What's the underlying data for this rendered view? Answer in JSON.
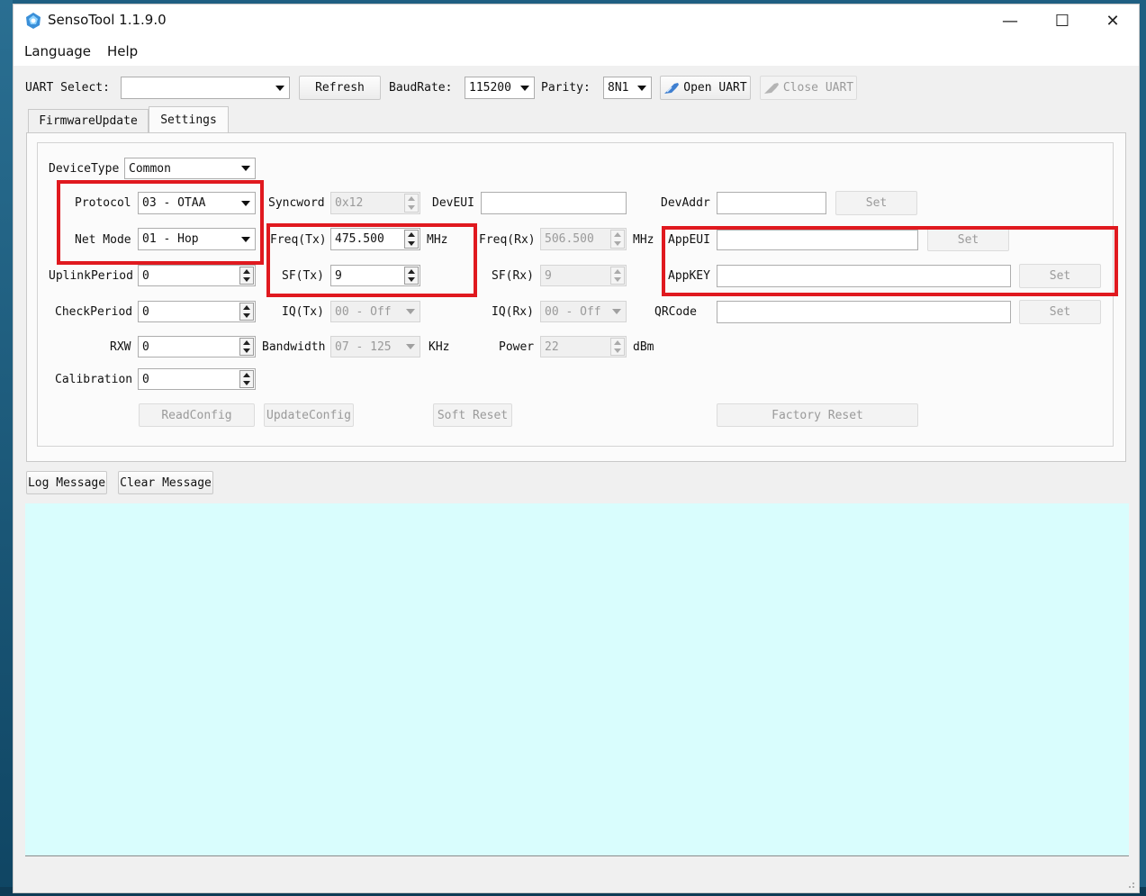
{
  "app": {
    "title": "SensoTool 1.1.9.0",
    "icon": "app-logo-icon"
  },
  "window_controls": {
    "minimize": "—",
    "maximize": "☐",
    "close": "✕"
  },
  "menu": {
    "items": [
      "Language",
      "Help"
    ]
  },
  "toolbar": {
    "uart_label": "UART Select:",
    "uart_value": "",
    "refresh": "Refresh",
    "baud_label": "BaudRate:",
    "baud_value": "115200",
    "parity_label": "Parity:",
    "parity_value": "8N1",
    "open_uart": "Open UART",
    "close_uart": "Close UART"
  },
  "tabs": [
    {
      "label": "FirmwareUpdate",
      "active": false
    },
    {
      "label": "Settings",
      "active": true
    }
  ],
  "settings": {
    "device_type": {
      "label": "DeviceType",
      "value": "Common"
    },
    "protocol": {
      "label": "Protocol",
      "value": "03 - OTAA"
    },
    "net_mode": {
      "label": "Net Mode",
      "value": "01 - Hop"
    },
    "uplink_period": {
      "label": "UplinkPeriod",
      "value": "0"
    },
    "check_period": {
      "label": "CheckPeriod",
      "value": "0"
    },
    "rxw": {
      "label": "RXW",
      "value": "0"
    },
    "calibration": {
      "label": "Calibration",
      "value": "0"
    },
    "syncword": {
      "label": "Syncword",
      "value": "0x12"
    },
    "freq_tx": {
      "label": "Freq(Tx)",
      "value": "475.500",
      "unit": "MHz"
    },
    "sf_tx": {
      "label": "SF(Tx)",
      "value": "9"
    },
    "iq_tx": {
      "label": "IQ(Tx)",
      "value": "00 - Off"
    },
    "bandwidth": {
      "label": "Bandwidth",
      "value": "07 - 125",
      "unit": "KHz"
    },
    "dev_eui": {
      "label": "DevEUI",
      "value": ""
    },
    "freq_rx": {
      "label": "Freq(Rx)",
      "value": "506.500",
      "unit": "MHz"
    },
    "sf_rx": {
      "label": "SF(Rx)",
      "value": "9"
    },
    "iq_rx": {
      "label": "IQ(Rx)",
      "value": "00 - Off"
    },
    "power": {
      "label": "Power",
      "value": "22",
      "unit": "dBm"
    },
    "dev_addr": {
      "label": "DevAddr",
      "value": ""
    },
    "app_eui": {
      "label": "AppEUI",
      "value": ""
    },
    "app_key": {
      "label": "AppKEY",
      "value": ""
    },
    "qrcode": {
      "label": "QRCode",
      "value": ""
    },
    "set_label": "Set",
    "read_config": "ReadConfig",
    "update_config": "UpdateConfig",
    "soft_reset": "Soft Reset",
    "factory_reset": "Factory Reset"
  },
  "log": {
    "log_message": "Log Message",
    "clear_message": "Clear Message",
    "content": "",
    "background": "#d9fdfd"
  },
  "highlight_color": "#e0191f"
}
